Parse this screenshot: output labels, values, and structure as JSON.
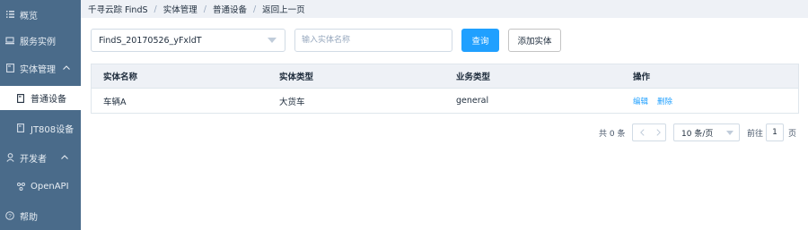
{
  "sidebar": {
    "items": [
      {
        "label": "概览",
        "icon": "list-icon"
      },
      {
        "label": "服务实例",
        "icon": "server-icon"
      },
      {
        "label": "实体管理",
        "icon": "folder-icon",
        "expanded": true
      },
      {
        "label": "普通设备",
        "icon": "device-icon",
        "active": true
      },
      {
        "label": "JT808设备",
        "icon": "device-icon"
      },
      {
        "label": "开发者",
        "icon": "user-icon",
        "expanded": true
      },
      {
        "label": "OpenAPI",
        "icon": "network-icon"
      },
      {
        "label": "帮助",
        "icon": "help-icon"
      }
    ],
    "chevron": "^"
  },
  "breadcrumb": [
    "千寻云踪 FindS",
    "实体管理",
    "普通设备",
    "返回上一页"
  ],
  "breadcrumb_sep": "/",
  "filters": {
    "service_select_value": "FindS_20170526_yFxldT",
    "entity_name_placeholder": "输入实体名称",
    "query_button": "查询",
    "add_button": "添加实体"
  },
  "table": {
    "columns": [
      "实体名称",
      "实体类型",
      "业务类型",
      "操作"
    ],
    "rows": [
      {
        "name": "车辆A",
        "type": "大货车",
        "business": "general",
        "actions": [
          "编辑",
          "删除"
        ]
      }
    ]
  },
  "pagination": {
    "total": "共 0 条",
    "prev": "<",
    "next": ">",
    "page_size": "10 条/页",
    "goto_label": "前往",
    "goto_value": "1",
    "page_suffix": "页"
  },
  "colors": {
    "sidebar_bg": "#4a6b8a",
    "primary": "#20a0ff",
    "header_bg": "#eef1f6"
  }
}
